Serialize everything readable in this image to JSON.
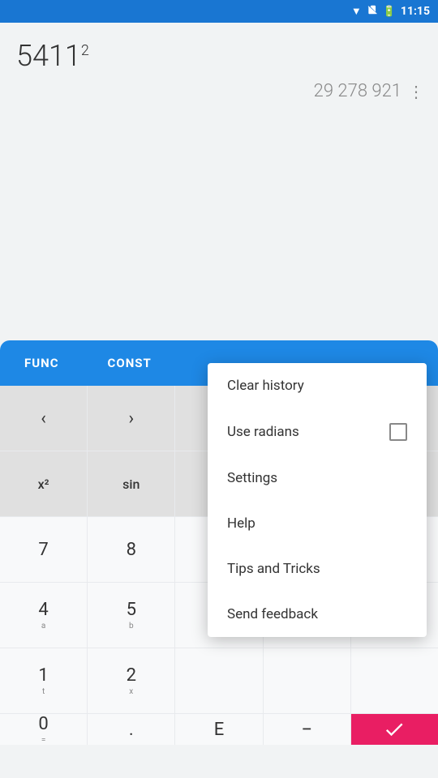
{
  "statusBar": {
    "time": "11:15",
    "icons": [
      "wifi",
      "sim-off",
      "battery"
    ]
  },
  "calculator": {
    "expression": "5411",
    "exponent": "2",
    "result": "29 278 921"
  },
  "tabs": [
    {
      "label": "FUNC",
      "active": false
    },
    {
      "label": "CONST",
      "active": false
    }
  ],
  "buttons": [
    {
      "label": "‹",
      "sub": "",
      "type": "nav"
    },
    {
      "label": "›",
      "sub": "",
      "type": "nav"
    },
    {
      "label": "",
      "sub": "",
      "type": "empty"
    },
    {
      "label": "",
      "sub": "",
      "type": "empty"
    },
    {
      "label": "",
      "sub": "",
      "type": "empty"
    },
    {
      "label": "x²",
      "sub": "",
      "type": "func"
    },
    {
      "label": "sin",
      "sub": "",
      "type": "func"
    },
    {
      "label": "",
      "sub": "",
      "type": "empty"
    },
    {
      "label": "",
      "sub": "",
      "type": "empty"
    },
    {
      "label": "",
      "sub": "",
      "type": "empty"
    },
    {
      "label": "7",
      "sub": "",
      "type": "num"
    },
    {
      "label": "8",
      "sub": "",
      "type": "num"
    },
    {
      "label": "",
      "sub": "",
      "type": "empty"
    },
    {
      "label": "",
      "sub": "",
      "type": "empty"
    },
    {
      "label": "",
      "sub": "",
      "type": "empty"
    },
    {
      "label": "4",
      "sub": "a",
      "type": "num"
    },
    {
      "label": "5",
      "sub": "b",
      "type": "num"
    },
    {
      "label": "",
      "sub": "",
      "type": "empty"
    },
    {
      "label": "",
      "sub": "",
      "type": "empty"
    },
    {
      "label": "",
      "sub": "",
      "type": "empty"
    },
    {
      "label": "1",
      "sub": "t",
      "type": "num"
    },
    {
      "label": "2",
      "sub": "x",
      "type": "num"
    },
    {
      "label": "",
      "sub": "",
      "type": "empty"
    },
    {
      "label": "",
      "sub": "",
      "type": "empty"
    },
    {
      "label": "",
      "sub": "",
      "type": "empty"
    },
    {
      "label": "0",
      "sub": "=",
      "type": "num"
    },
    {
      "label": ".",
      "sub": "",
      "type": "num"
    },
    {
      "label": "E",
      "sub": "",
      "type": "num"
    },
    {
      "label": "−",
      "sub": "",
      "type": "operator"
    },
    {
      "label": "●",
      "sub": "",
      "type": "pink"
    }
  ],
  "menu": {
    "items": [
      {
        "label": "Clear history",
        "hasCheckbox": false
      },
      {
        "label": "Use radians",
        "hasCheckbox": true,
        "checked": false
      },
      {
        "label": "Settings",
        "hasCheckbox": false
      },
      {
        "label": "Help",
        "hasCheckbox": false
      },
      {
        "label": "Tips and Tricks",
        "hasCheckbox": false
      },
      {
        "label": "Send feedback",
        "hasCheckbox": false
      }
    ]
  }
}
